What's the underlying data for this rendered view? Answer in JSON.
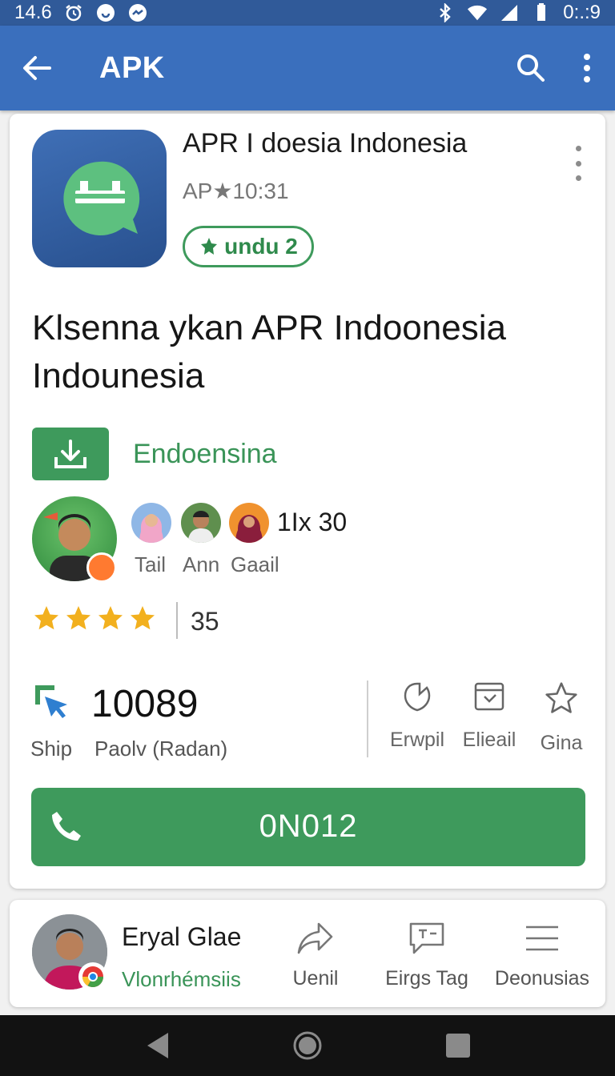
{
  "status_bar": {
    "time": "14.6",
    "clock": "0:.:9"
  },
  "app_bar": {
    "title": "APK"
  },
  "app": {
    "name": "APR I doesia Indonesia",
    "subtitle": "AP★10:31",
    "chip_label": "undu 2"
  },
  "headline": "Klsenna ykan APR Indoonesia Indounesia",
  "download": {
    "label": "Endoensina"
  },
  "social": {
    "count_text": "1Ix 30",
    "people": [
      "Tail",
      "Ann",
      "Gaail"
    ]
  },
  "rating": {
    "stars": 4,
    "value": "35"
  },
  "stats": {
    "number": "10089",
    "ship_label": "Ship",
    "number_label": "Paolv (Radan)",
    "actions": [
      "Erwpil",
      "Elieail",
      "Gina"
    ]
  },
  "call_button": {
    "label": "0N012"
  },
  "bottom": {
    "name": "Eryal Glae",
    "subtitle": "Vlonrhémsiis",
    "actions": [
      "Uenil",
      "Eirgs Tag",
      "Deonusias"
    ]
  },
  "colors": {
    "app_bar": "#3a6fbd",
    "status_bar": "#305a99",
    "accent_green": "#3e9a5c",
    "star": "#f2b01e"
  }
}
